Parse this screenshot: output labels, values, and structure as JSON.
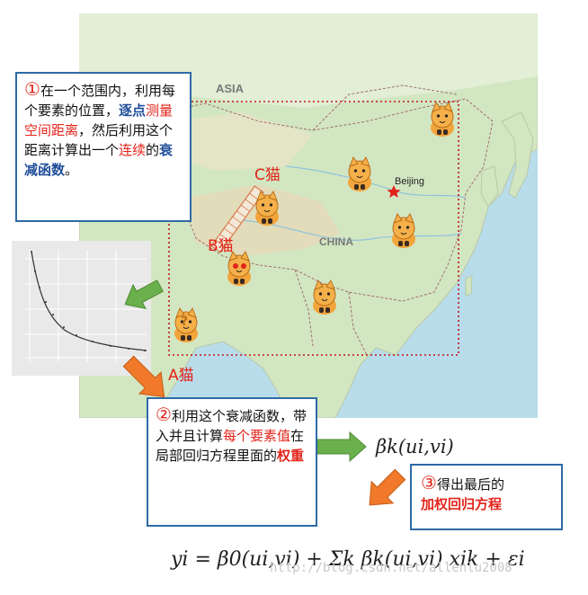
{
  "map": {
    "asia_label": "ASIA",
    "china_label": "CHINA",
    "beijing_label": "Beijing",
    "cat_a": "A猫",
    "cat_b": "B猫",
    "cat_c": "C猫"
  },
  "step1": {
    "number": "①",
    "t1": "在一个范围内，利用每个要素的位置，",
    "t2": "逐点",
    "t3": "测量空间距离",
    "t4": "，然后利用这个距离计算出一个",
    "t5": "连续",
    "t6": "的",
    "t7": "衰减函数",
    "t8": "。"
  },
  "step2": {
    "number": "②",
    "t1": "利用这个衰减函数，带入并且计算",
    "t2": "每个要素值",
    "t3": "在局部回归方程里面的",
    "t4": "权重"
  },
  "step3": {
    "number": "③",
    "t1": "得出最后的",
    "t2": "加权回归方程"
  },
  "formula_beta": "βk(ui,vi)",
  "formula_main": "yi = β0(ui,vi) + Σk βk(ui,vi) xik + εi",
  "watermark": "http://blog.csdn.net/allenlu2008",
  "colors": {
    "box_border": "#2f6aa6",
    "highlight_red": "#e2231a",
    "highlight_blue": "#1f4e99",
    "arrow_green": "#6ab04c",
    "arrow_orange": "#f07a2a",
    "study_area": "#c0141a"
  }
}
